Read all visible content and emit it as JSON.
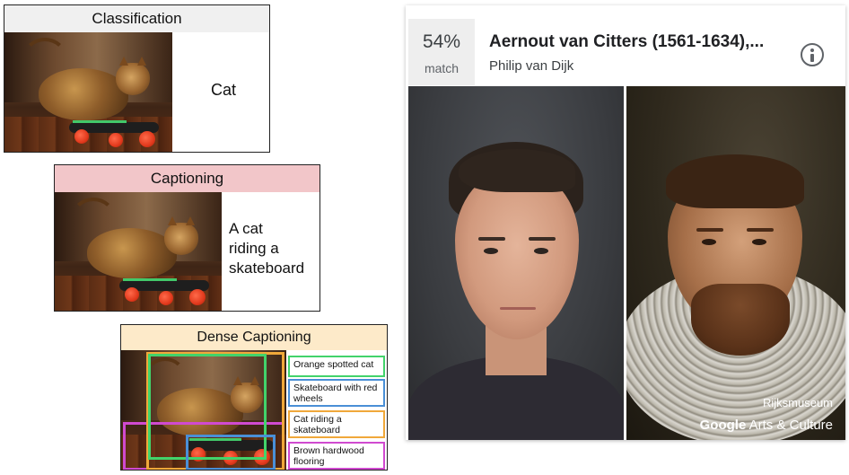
{
  "classification": {
    "header": "Classification",
    "header_bg": "#f0f0f0",
    "result": "Cat"
  },
  "captioning": {
    "header": "Captioning",
    "header_bg": "#f2c6c9",
    "result_lines": [
      "A cat",
      "riding a",
      "skateboard"
    ]
  },
  "dense_captioning": {
    "header": "Dense Captioning",
    "header_bg": "#fdeac9",
    "captions": [
      {
        "text": "Orange spotted cat",
        "color": "#42d36b"
      },
      {
        "text": "Skateboard with red wheels",
        "color": "#4a8fd6"
      },
      {
        "text": "Cat riding a skateboard",
        "color": "#f0a83a"
      },
      {
        "text": "Brown hardwood flooring",
        "color": "#d04ad0"
      }
    ]
  },
  "card": {
    "match_percent": "54%",
    "match_label": "match",
    "title": "Aernout van Citters (1561-1634),...",
    "artist": "Philip van Dijk",
    "info_icon": "info-icon",
    "museum": "Rijksmuseum",
    "brand_google": "Google",
    "brand_rest": " Arts & Culture"
  }
}
